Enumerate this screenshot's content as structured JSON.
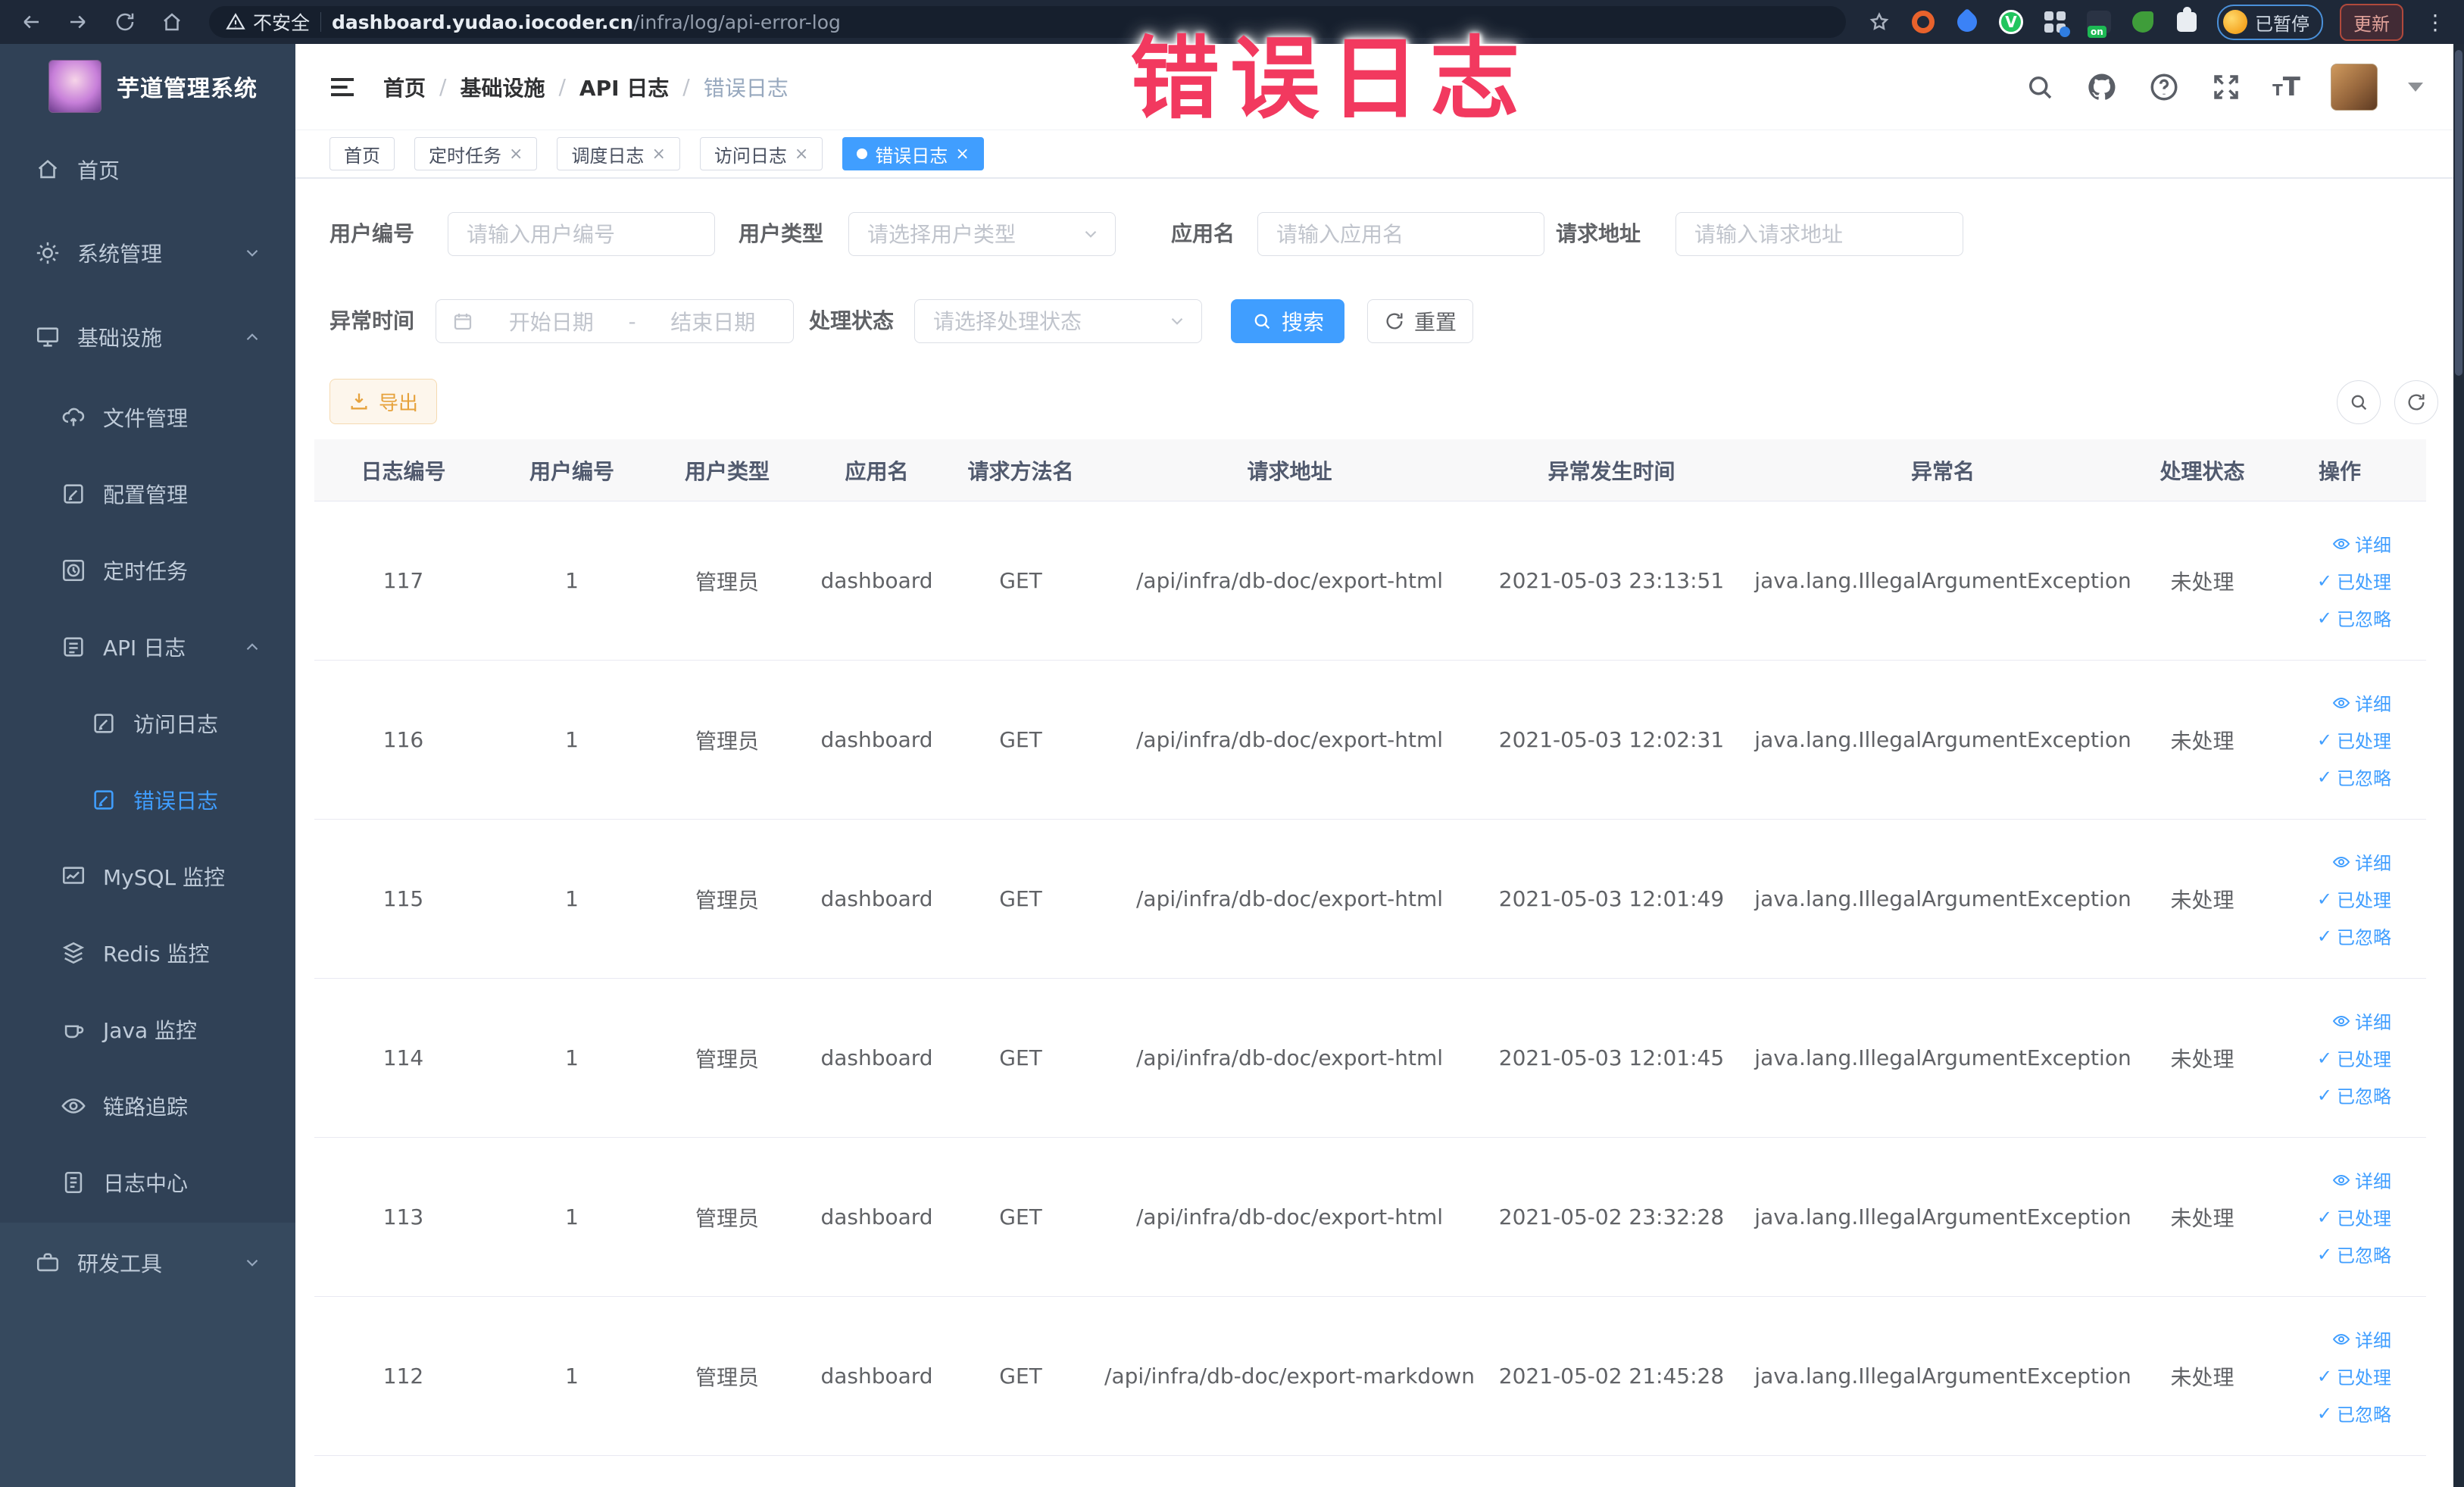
{
  "browser": {
    "security_label": "不安全",
    "url_domain": "dashboard.yudao.iocoder.cn",
    "url_path": "/infra/log/api-error-log",
    "paused_badge": "已暂停",
    "update_button": "更新"
  },
  "sidebar": {
    "title": "芋道管理系统",
    "items": [
      {
        "label": "首页"
      },
      {
        "label": "系统管理"
      },
      {
        "label": "基础设施"
      },
      {
        "label": "文件管理"
      },
      {
        "label": "配置管理"
      },
      {
        "label": "定时任务"
      },
      {
        "label": "API 日志"
      },
      {
        "label": "访问日志"
      },
      {
        "label": "错误日志"
      },
      {
        "label": "MySQL 监控"
      },
      {
        "label": "Redis 监控"
      },
      {
        "label": "Java 监控"
      },
      {
        "label": "链路追踪"
      },
      {
        "label": "日志中心"
      },
      {
        "label": "研发工具"
      }
    ]
  },
  "breadcrumb": [
    "首页",
    "基础设施",
    "API 日志",
    "错误日志"
  ],
  "tabs": [
    {
      "label": "首页"
    },
    {
      "label": "定时任务"
    },
    {
      "label": "调度日志"
    },
    {
      "label": "访问日志"
    },
    {
      "label": "错误日志"
    }
  ],
  "filters": {
    "user_id_label": "用户编号",
    "user_id_placeholder": "请输入用户编号",
    "user_type_label": "用户类型",
    "user_type_placeholder": "请选择用户类型",
    "app_name_label": "应用名",
    "app_name_placeholder": "请输入应用名",
    "request_url_label": "请求地址",
    "request_url_placeholder": "请输入请求地址",
    "exception_time_label": "异常时间",
    "date_start_placeholder": "开始日期",
    "date_separator": "-",
    "date_end_placeholder": "结束日期",
    "process_status_label": "处理状态",
    "process_status_placeholder": "请选择处理状态",
    "search_label": "搜索",
    "reset_label": "重置"
  },
  "toolbar": {
    "export_label": "导出"
  },
  "table": {
    "columns": [
      "日志编号",
      "用户编号",
      "用户类型",
      "应用名",
      "请求方法名",
      "请求地址",
      "异常发生时间",
      "异常名",
      "处理状态",
      "操作"
    ],
    "actions": [
      {
        "label": "详细"
      },
      {
        "label": "已处理"
      },
      {
        "label": "已忽略"
      }
    ],
    "rows": [
      {
        "id": "117",
        "user_id": "1",
        "user_type": "管理员",
        "app": "dashboard",
        "method": "GET",
        "url": "/api/infra/db-doc/export-html",
        "time": "2021-05-03 23:13:51",
        "exception": "java.lang.IllegalArgumentException",
        "status": "未处理"
      },
      {
        "id": "116",
        "user_id": "1",
        "user_type": "管理员",
        "app": "dashboard",
        "method": "GET",
        "url": "/api/infra/db-doc/export-html",
        "time": "2021-05-03 12:02:31",
        "exception": "java.lang.IllegalArgumentException",
        "status": "未处理"
      },
      {
        "id": "115",
        "user_id": "1",
        "user_type": "管理员",
        "app": "dashboard",
        "method": "GET",
        "url": "/api/infra/db-doc/export-html",
        "time": "2021-05-03 12:01:49",
        "exception": "java.lang.IllegalArgumentException",
        "status": "未处理"
      },
      {
        "id": "114",
        "user_id": "1",
        "user_type": "管理员",
        "app": "dashboard",
        "method": "GET",
        "url": "/api/infra/db-doc/export-html",
        "time": "2021-05-03 12:01:45",
        "exception": "java.lang.IllegalArgumentException",
        "status": "未处理"
      },
      {
        "id": "113",
        "user_id": "1",
        "user_type": "管理员",
        "app": "dashboard",
        "method": "GET",
        "url": "/api/infra/db-doc/export-html",
        "time": "2021-05-02 23:32:28",
        "exception": "java.lang.IllegalArgumentException",
        "status": "未处理"
      },
      {
        "id": "112",
        "user_id": "1",
        "user_type": "管理员",
        "app": "dashboard",
        "method": "GET",
        "url": "/api/infra/db-doc/export-markdown",
        "time": "2021-05-02 21:45:28",
        "exception": "java.lang.IllegalArgumentException",
        "status": "未处理"
      }
    ]
  },
  "annotation": {
    "text": "错误日志"
  },
  "colors": {
    "accent": "#409eff",
    "warning": "#e6a23c",
    "annotation_red": "#f2395f",
    "sidebar_bg": "#304156",
    "chrome_bg": "#1e2838"
  }
}
